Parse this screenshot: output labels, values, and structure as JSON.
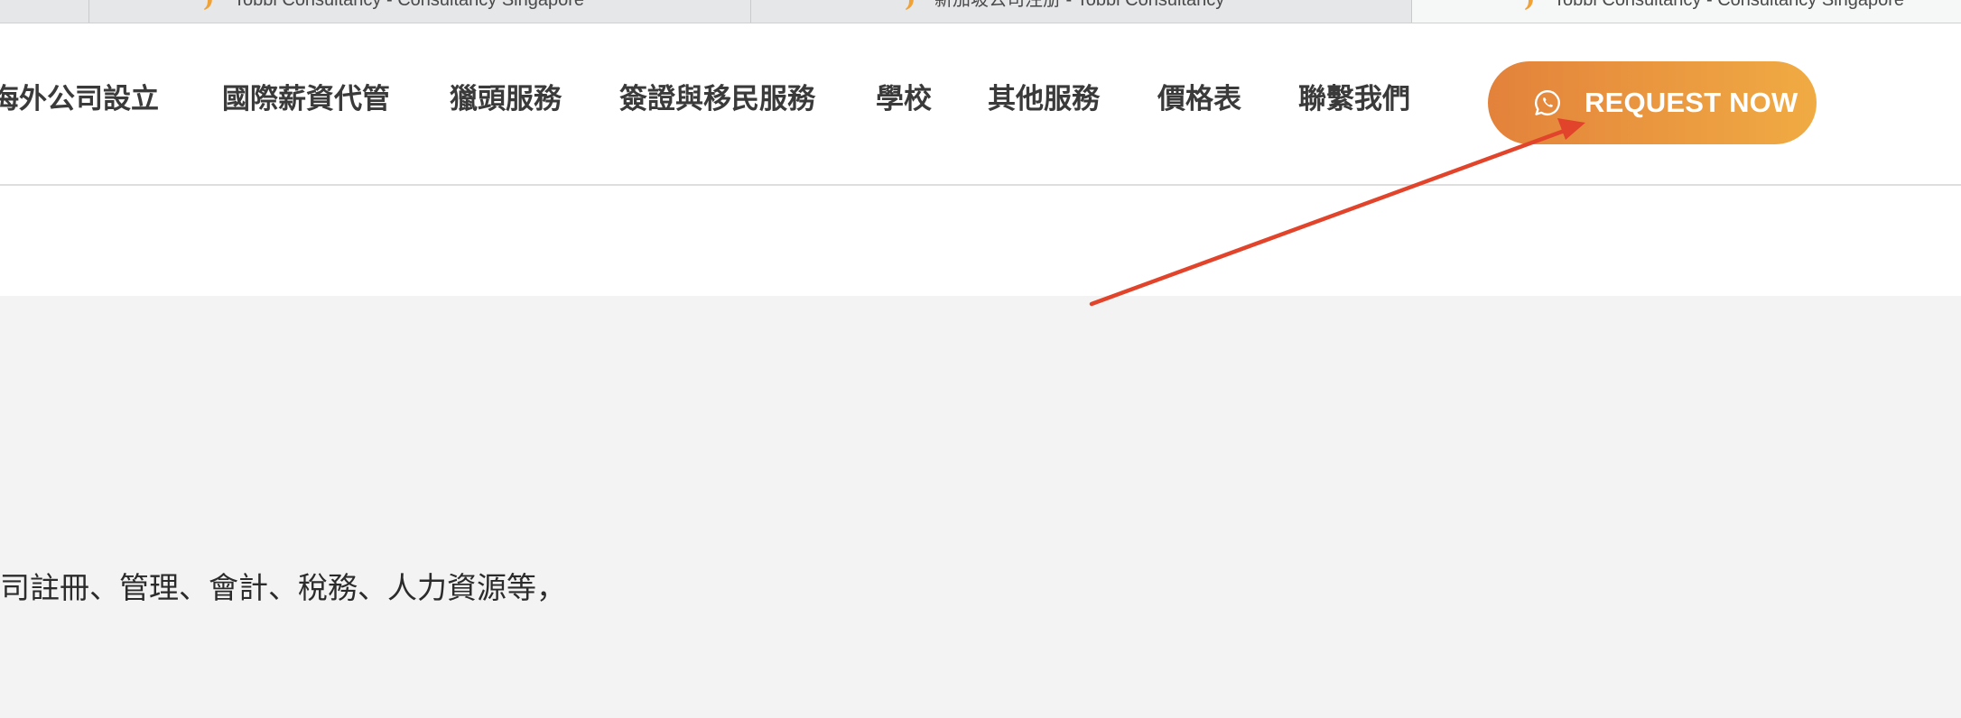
{
  "browser": {
    "tabs": [
      {
        "title": "Tobbi Consultancy - Consultancy Singapore",
        "active": false
      },
      {
        "title": "新加坡公司注册 - Tobbi Consultancy",
        "active": false
      },
      {
        "title": "Tobbi Consultancy - Consultancy Singapore",
        "active": true
      }
    ]
  },
  "nav": {
    "items": [
      "海外公司設立",
      "國際薪資代管",
      "獵頭服務",
      "簽證與移民服務",
      "學校",
      "其他服務",
      "價格表",
      "聯繫我們"
    ],
    "cta": {
      "label": "REQUEST NOW",
      "icon": "whatsapp-icon",
      "gradient_start": "#e3823b",
      "gradient_end": "#f0ab43"
    }
  },
  "content": {
    "text": "司註冊、管理、會計、稅務、人力資源等，"
  },
  "annotation": {
    "type": "arrow",
    "color": "#e1442b",
    "points_to": "cta-button"
  },
  "colors": {
    "page_background": "#f3f3f3",
    "header_background": "#ffffff",
    "nav_text": "#3a3a3a"
  }
}
